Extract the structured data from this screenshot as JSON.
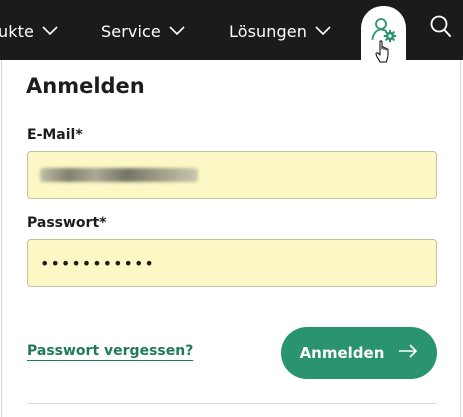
{
  "nav": {
    "items": [
      {
        "label": "ukte"
      },
      {
        "label": "Service"
      },
      {
        "label": "Lösungen"
      }
    ]
  },
  "login": {
    "title": "Anmelden",
    "email_label": "E-Mail*",
    "email_value": "",
    "password_label": "Passwort*",
    "password_value": "•••••••••••",
    "forgot_label": "Passwort vergessen?",
    "submit_label": "Anmelden"
  },
  "colors": {
    "nav_bg": "#1b1b1b",
    "accent": "#2a9470",
    "input_autofill_bg": "#fbf8c5"
  },
  "icons": [
    "chevron-down-icon",
    "user-settings-icon",
    "search-icon",
    "hand-cursor-icon",
    "arrow-right-icon"
  ]
}
